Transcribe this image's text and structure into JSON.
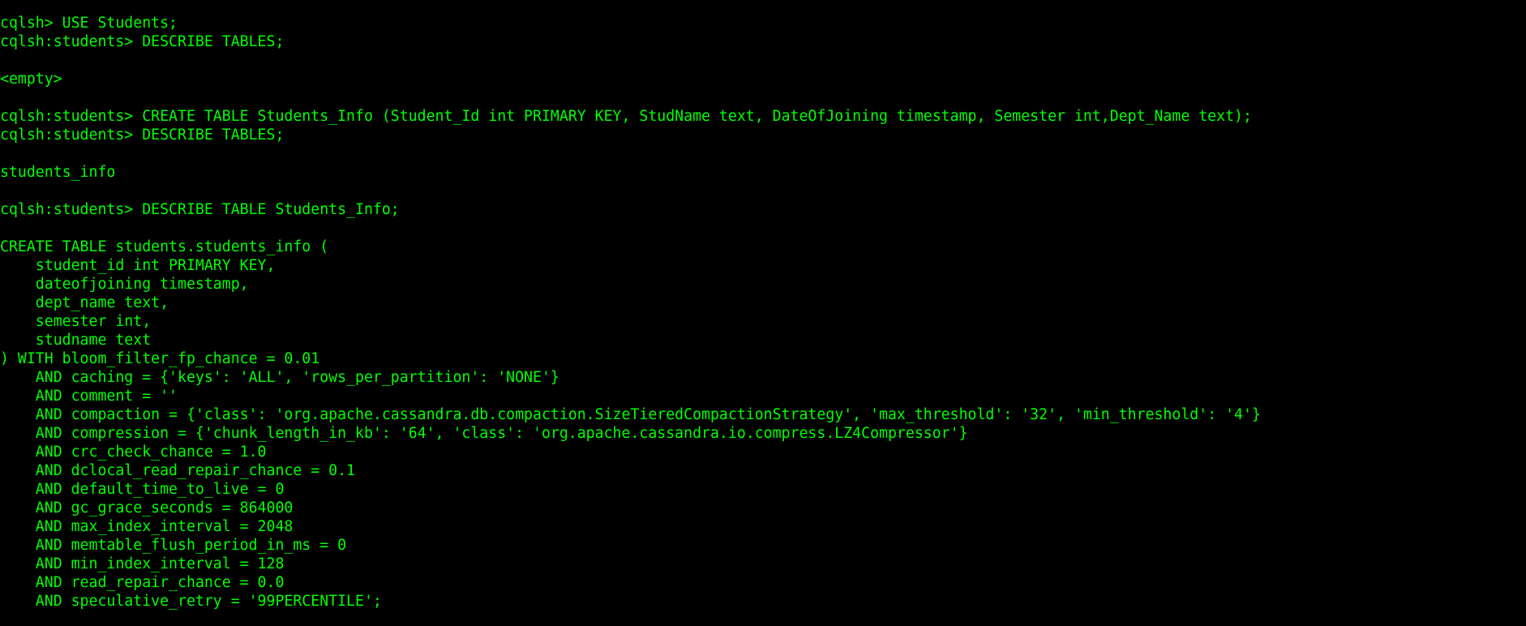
{
  "terminal": {
    "text_color": "#00ff00",
    "background_color": "#000000",
    "lines": [
      "cqlsh> USE Students;",
      "cqlsh:students> DESCRIBE TABLES;",
      "",
      "<empty>",
      "",
      "cqlsh:students> CREATE TABLE Students_Info (Student_Id int PRIMARY KEY, StudName text, DateOfJoining timestamp, Semester int,Dept_Name text);",
      "cqlsh:students> DESCRIBE TABLES;",
      "",
      "students_info",
      "",
      "cqlsh:students> DESCRIBE TABLE Students_Info;",
      "",
      "CREATE TABLE students.students_info (",
      "    student_id int PRIMARY KEY,",
      "    dateofjoining timestamp,",
      "    dept_name text,",
      "    semester int,",
      "    studname text",
      ") WITH bloom_filter_fp_chance = 0.01",
      "    AND caching = {'keys': 'ALL', 'rows_per_partition': 'NONE'}",
      "    AND comment = ''",
      "    AND compaction = {'class': 'org.apache.cassandra.db.compaction.SizeTieredCompactionStrategy', 'max_threshold': '32', 'min_threshold': '4'}",
      "    AND compression = {'chunk_length_in_kb': '64', 'class': 'org.apache.cassandra.io.compress.LZ4Compressor'}",
      "    AND crc_check_chance = 1.0",
      "    AND dclocal_read_repair_chance = 0.1",
      "    AND default_time_to_live = 0",
      "    AND gc_grace_seconds = 864000",
      "    AND max_index_interval = 2048",
      "    AND memtable_flush_period_in_ms = 0",
      "    AND min_index_interval = 128",
      "    AND read_repair_chance = 0.0",
      "    AND speculative_retry = '99PERCENTILE';"
    ]
  }
}
